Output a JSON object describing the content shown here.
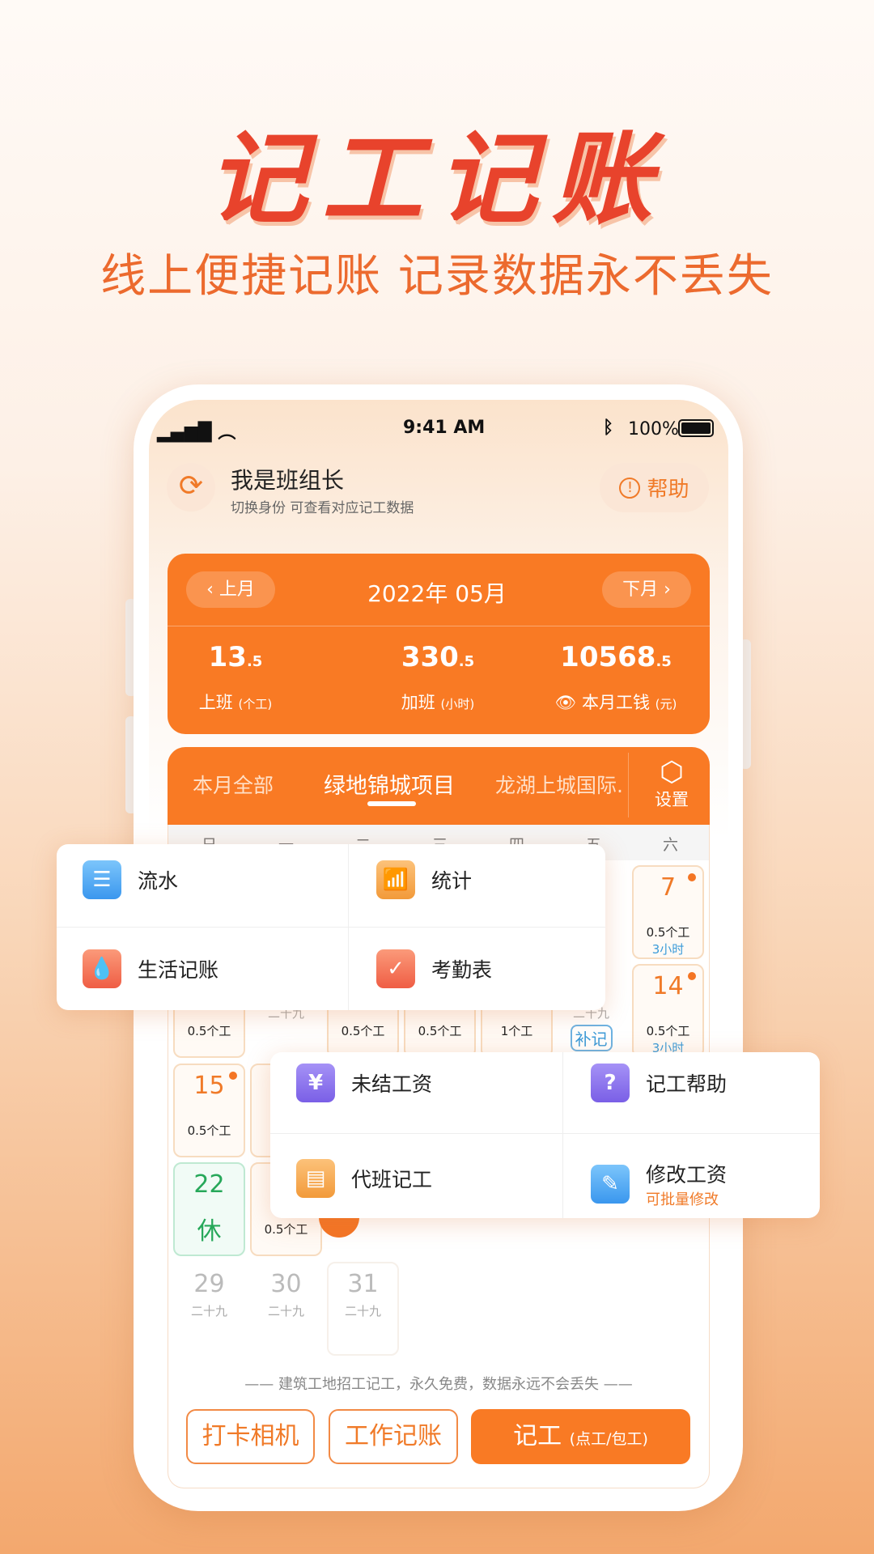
{
  "hero": {
    "title": "记工记账",
    "subtitle": "线上便捷记账 记录数据永不丢失"
  },
  "status_bar": {
    "time": "9:41 AM",
    "battery": "100%"
  },
  "header": {
    "title": "我是班组长",
    "subtitle": "切换身份 可查看对应记工数据",
    "help": "帮助"
  },
  "month": {
    "prev": "上月",
    "current": "2022年 05月",
    "next": "下月"
  },
  "stats": [
    {
      "value": "13",
      "decimal": ".5",
      "label": "上班",
      "unit": "(个工)"
    },
    {
      "value": "330",
      "decimal": ".5",
      "label": "加班",
      "unit": "(小时)"
    },
    {
      "value": "10568",
      "decimal": ".5",
      "label": "本月工钱",
      "unit": "(元)"
    }
  ],
  "tabs": [
    "本月全部",
    "绿地锦城项目",
    "龙湖上城国际."
  ],
  "settings": "设置",
  "weekdays": [
    "日",
    "一",
    "二",
    "三",
    "四",
    "五",
    "六"
  ],
  "days": {
    "d7": {
      "day": "7",
      "work": "0.5个工",
      "ot": "3小时"
    },
    "d8": {
      "work": "0.5个工"
    },
    "d9": {
      "lunar": "二十九"
    },
    "d10": {
      "work": "0.5个工"
    },
    "d11": {
      "work": "0.5个工"
    },
    "d12": {
      "work": "1个工"
    },
    "d13": {
      "lunar": "二十九",
      "badge": "补记"
    },
    "d14": {
      "day": "14",
      "work": "0.5个工",
      "ot": "3小时"
    },
    "d15": {
      "day": "15",
      "work": "0.5个工"
    },
    "d22": {
      "day": "22",
      "rest": "休"
    },
    "d23": {
      "work": "0.5个工"
    },
    "d29": {
      "day": "29",
      "lunar": "二十九"
    },
    "d30": {
      "day": "30",
      "lunar": "二十九"
    },
    "d31": {
      "day": "31",
      "lunar": "二十九"
    }
  },
  "menu1": [
    {
      "label": "流水",
      "icon": "list-icon"
    },
    {
      "label": "统计",
      "icon": "chart-icon"
    },
    {
      "label": "生活记账",
      "icon": "drop-icon"
    },
    {
      "label": "考勤表",
      "icon": "calendar-check-icon"
    }
  ],
  "menu2": [
    {
      "label": "未结工资",
      "icon": "yen-icon",
      "glyph": "¥"
    },
    {
      "label": "记工帮助",
      "icon": "question-icon",
      "glyph": "?"
    },
    {
      "label": "代班记工",
      "icon": "note-icon"
    },
    {
      "label": "修改工资",
      "sub": "可批量修改",
      "icon": "edit-icon"
    }
  ],
  "footer": {
    "slogan": "建筑工地招工记工，永久免费，数据永远不会丢失",
    "camera": "打卡相机",
    "work_account": "工作记账",
    "record": "记工",
    "record_sub": "(点工/包工)"
  },
  "colors": {
    "accent": "#f97a24",
    "rest": "#27a85a",
    "ot": "#3b9bd9"
  }
}
